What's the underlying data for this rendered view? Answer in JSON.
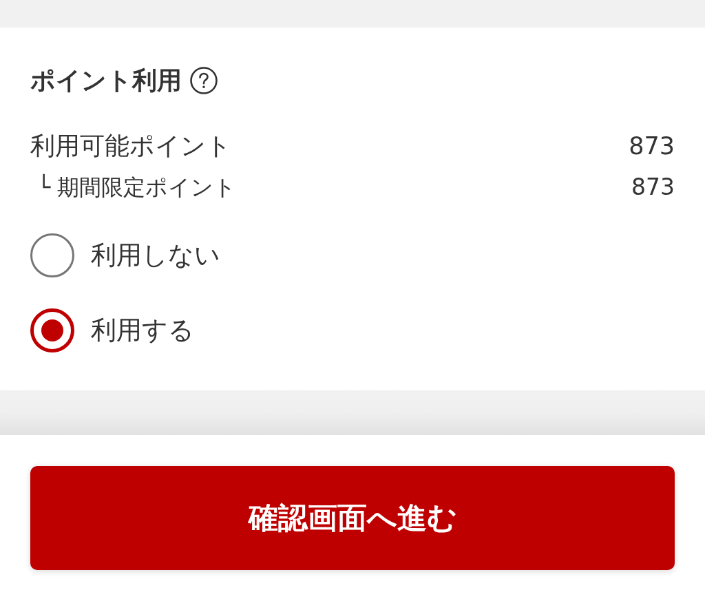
{
  "section": {
    "title": "ポイント利用"
  },
  "points": [
    {
      "kind": "total",
      "label": "利用可能ポイント",
      "value": "873"
    },
    {
      "kind": "sub",
      "label": "└ 期間限定ポイント",
      "value": "873"
    }
  ],
  "options": [
    {
      "label": "利用しない",
      "selected": false
    },
    {
      "label": "利用する",
      "selected": true
    }
  ],
  "button": {
    "label": "確認画面へ進む"
  }
}
